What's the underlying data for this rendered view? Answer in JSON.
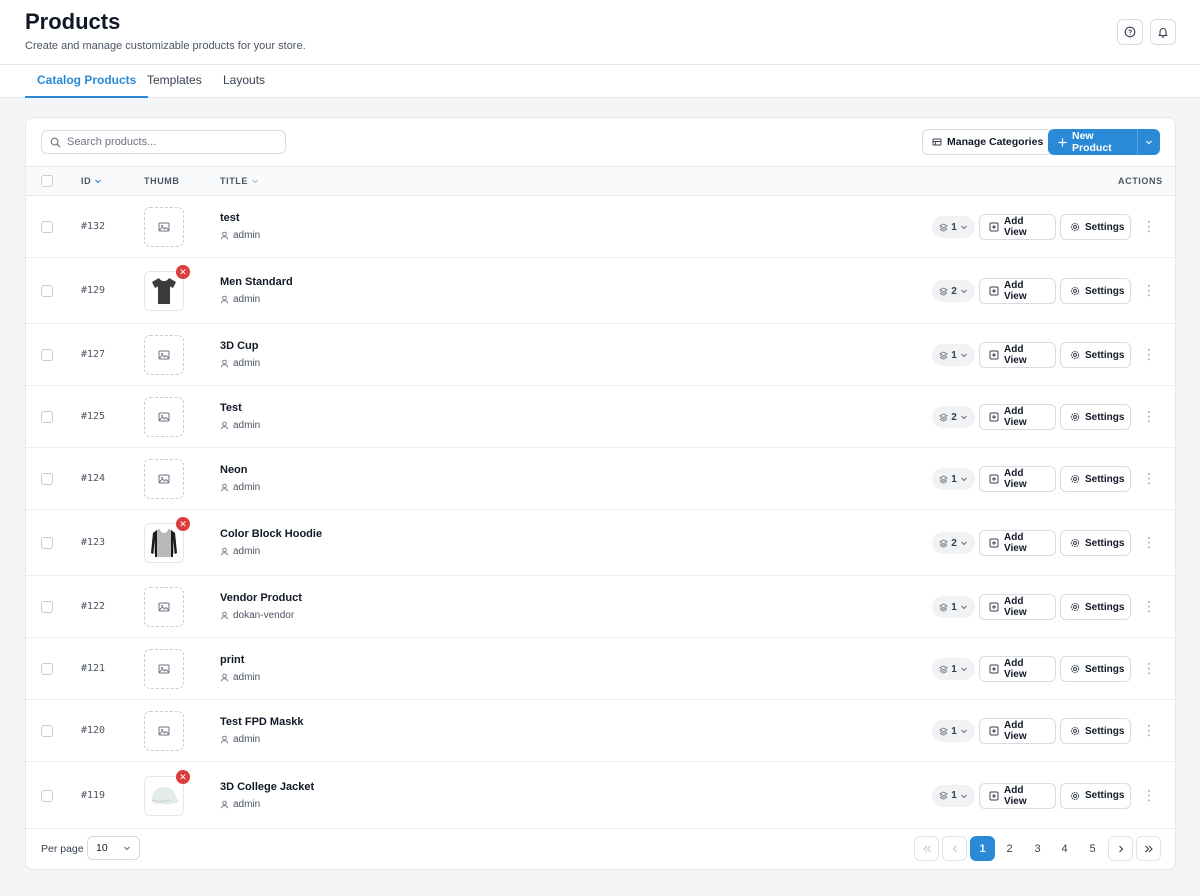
{
  "header": {
    "title": "Products",
    "subtitle": "Create and manage customizable products for your store."
  },
  "tabs": [
    {
      "label": "Catalog Products",
      "active": true
    },
    {
      "label": "Templates",
      "active": false
    },
    {
      "label": "Layouts",
      "active": false
    }
  ],
  "toolbar": {
    "search_placeholder": "Search products...",
    "manage_categories": "Manage Categories",
    "new_product": "New Product"
  },
  "table": {
    "headers": {
      "id": "ID",
      "thumb": "THUMB",
      "title": "TITLE",
      "actions": "ACTIONS"
    },
    "add_view_label": "Add View",
    "settings_label": "Settings",
    "rows": [
      {
        "id": "#132",
        "title": "test",
        "author": "admin",
        "views": "1",
        "thumb": "placeholder"
      },
      {
        "id": "#129",
        "title": "Men Standard",
        "author": "admin",
        "views": "2",
        "thumb": "tshirt"
      },
      {
        "id": "#127",
        "title": "3D Cup",
        "author": "admin",
        "views": "1",
        "thumb": "placeholder"
      },
      {
        "id": "#125",
        "title": "Test",
        "author": "admin",
        "views": "2",
        "thumb": "placeholder"
      },
      {
        "id": "#124",
        "title": "Neon",
        "author": "admin",
        "views": "1",
        "thumb": "placeholder"
      },
      {
        "id": "#123",
        "title": "Color Block Hoodie",
        "author": "admin",
        "views": "2",
        "thumb": "hoodie"
      },
      {
        "id": "#122",
        "title": "Vendor Product",
        "author": "dokan-vendor",
        "views": "1",
        "thumb": "placeholder"
      },
      {
        "id": "#121",
        "title": "print",
        "author": "admin",
        "views": "1",
        "thumb": "placeholder"
      },
      {
        "id": "#120",
        "title": "Test FPD Maskk",
        "author": "admin",
        "views": "1",
        "thumb": "placeholder"
      },
      {
        "id": "#119",
        "title": "3D College Jacket",
        "author": "admin",
        "views": "1",
        "thumb": "cap"
      }
    ]
  },
  "pagination": {
    "per_page_label": "Per page",
    "per_page_value": "10",
    "pages": [
      "1",
      "2",
      "3",
      "4",
      "5"
    ],
    "current_page": "1"
  },
  "colors": {
    "accent": "#2b8ad8",
    "remove": "#dc3c3c"
  }
}
